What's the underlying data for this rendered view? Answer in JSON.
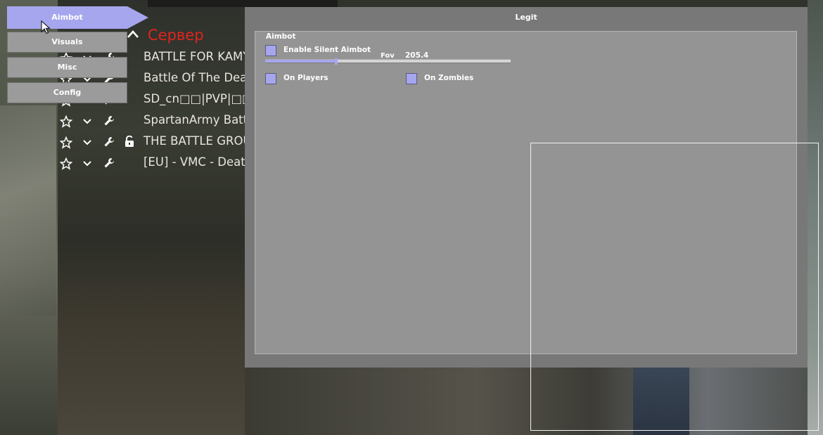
{
  "colors": {
    "accent": "#a6a6ee",
    "panel_bg": "#787878",
    "group_bg": "#949494",
    "tab_bg": "#9b9b9b",
    "server_header": "#e0241d"
  },
  "server_list": {
    "header": "Сервер",
    "rows": [
      {
        "name": "BATTLE FOR KAMY",
        "locked": false
      },
      {
        "name": "Battle Of The Dead",
        "locked": false
      },
      {
        "name": "SD_cn□□|PVP|□□|",
        "locked": false
      },
      {
        "name": "SpartanArmy Battle",
        "locked": false
      },
      {
        "name": "THE BATTLE GROU",
        "locked": true
      },
      {
        "name": "[EU] - VMC - Death",
        "locked": false
      }
    ]
  },
  "nav": {
    "tabs": [
      {
        "label": "Aimbot",
        "active": true
      },
      {
        "label": "Visuals",
        "active": false
      },
      {
        "label": "Misc",
        "active": false
      },
      {
        "label": "Config",
        "active": false
      }
    ]
  },
  "panel": {
    "title": "Legit",
    "group": {
      "title": "Aimbot",
      "silent_aimbot": {
        "label": "Enable Silent Aimbot",
        "checked": true
      },
      "fov": {
        "label": "Fov",
        "value": "205.4",
        "fraction": 0.29
      },
      "on_players": {
        "label": "On Players",
        "checked": true
      },
      "on_zombies": {
        "label": "On Zombies",
        "checked": true
      }
    }
  }
}
